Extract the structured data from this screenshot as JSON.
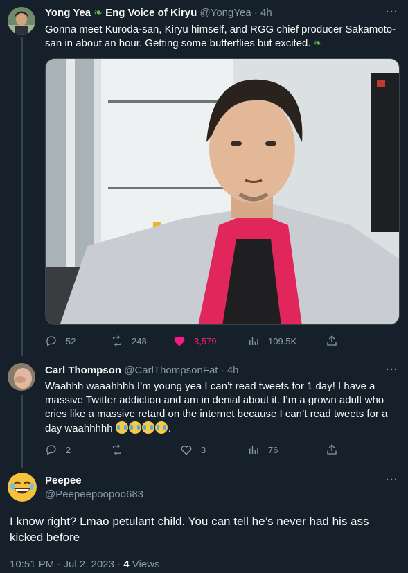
{
  "tweet1": {
    "name": "Yong Yea",
    "name_suffix": "Eng Voice of Kiryu",
    "handle": "@YongYea",
    "time": "4h",
    "text": "Gonna meet Kuroda-san, Kiryu himself, and RGG chief producer Sakamoto-san in about an hour. Getting some butterflies but excited.",
    "replies": "52",
    "retweets": "248",
    "likes": "3,579",
    "views": "109.5K"
  },
  "tweet2": {
    "name": "Carl Thompson",
    "handle": "@CarlThompsonFat",
    "time": "4h",
    "text": "Waahhh waaahhhh I’m young yea I can’t read tweets for 1 day! I have a massive Twitter addiction and am in denial about it. I’m a grown adult who cries like a massive retard on the internet because I can’t read tweets for a day waahhhhh",
    "text_end": ".",
    "replies": "2",
    "retweets": "",
    "likes": "3",
    "views": "76"
  },
  "tweet3": {
    "name": "Peepee",
    "handle": "@Peepeepoopoo683",
    "text": "I know right? Lmao petulant child. You can tell he’s never had his ass kicked before",
    "timestamp": "10:51 PM · Jul 2, 2023 · ",
    "views_count": "4",
    "views_label": " Views"
  },
  "ui": {
    "more": "···",
    "dot": " · "
  },
  "colors": {
    "background": "#15202b",
    "secondary_text": "#8b98a5",
    "like_pink": "#f91880",
    "divider": "#38444d"
  }
}
